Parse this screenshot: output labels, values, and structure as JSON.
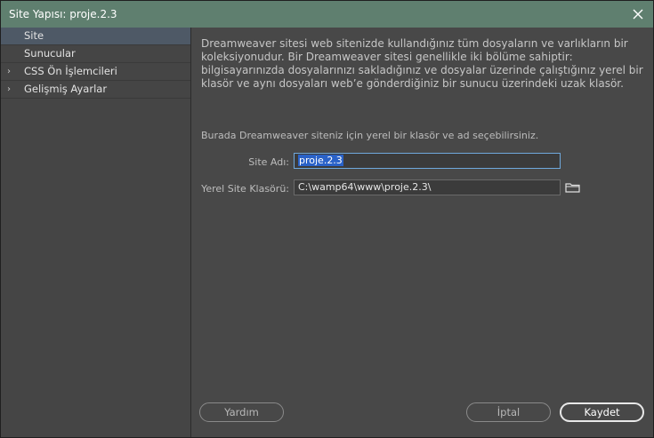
{
  "window": {
    "title": "Site Yapısı: proje.2.3"
  },
  "sidebar": {
    "items": [
      {
        "label": "Site",
        "expandable": false,
        "selected": true
      },
      {
        "label": "Sunucular",
        "expandable": false,
        "selected": false
      },
      {
        "label": "CSS Ön İşlemcileri",
        "expandable": true,
        "selected": false
      },
      {
        "label": "Gelişmiş Ayarlar",
        "expandable": true,
        "selected": false
      }
    ]
  },
  "main": {
    "description_lines": [
      "Dreamweaver sitesi web sitenizde kullandığınız tüm dosyaların ve varlıkların bir",
      "koleksiyonudur. Bir Dreamweaver sitesi genellikle iki bölüme sahiptir:",
      "bilgisayarınızda dosyalarınızı sakladığınız ve dosyalar üzerinde çalıştığınız yerel bir",
      "klasör ve aynı dosyaları web’e gönderdiğiniz bir sunucu üzerindeki uzak klasör."
    ],
    "hint": "Burada Dreamweaver siteniz için yerel bir klasör ve ad seçebilirsiniz.",
    "site_name_label": "Site Adı:",
    "site_name_value": "proje.2.3",
    "local_folder_label": "Yerel Site Klasörü:",
    "local_folder_value": "C:\\wamp64\\www\\proje.2.3\\",
    "folder_icon": "folder-icon"
  },
  "buttons": {
    "help": "Yardım",
    "cancel": "İptal",
    "save": "Kaydet"
  },
  "colors": {
    "titlebar": "#5f7f6f",
    "selected_item": "#4e5966",
    "text_selection": "#2a62c8"
  }
}
